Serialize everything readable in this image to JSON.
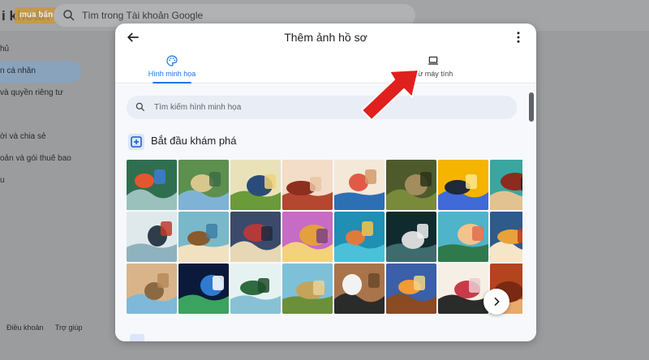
{
  "background": {
    "app_title": "i khoản",
    "logo_text": "mua bán",
    "search_placeholder": "Tìm trong Tài khoản Google",
    "nav": [
      {
        "label": "hủ",
        "active": false
      },
      {
        "label": "n cá nhân",
        "active": true
      },
      {
        "label": "và quyền riêng tư",
        "active": false
      },
      {
        "label": "",
        "active": false
      },
      {
        "label": "ời và chia sẻ",
        "active": false
      },
      {
        "label": "oản và gói thuê bao",
        "active": false
      },
      {
        "label": "u",
        "active": false
      }
    ],
    "footer": [
      "Điều khoản",
      "Trợ giúp"
    ]
  },
  "dialog": {
    "title": "Thêm ảnh hồ sơ",
    "tabs": [
      {
        "label": "Hình minh họa",
        "icon": "palette-icon",
        "active": true
      },
      {
        "label": "Từ máy tính",
        "icon": "laptop-icon",
        "active": false
      }
    ],
    "search_placeholder": "Tìm kiếm hình minh họa",
    "section_title": "Bắt đầu khám phá",
    "thumbnails": [
      {
        "name": "thumb-chameleon",
        "colors": [
          "#2f6f4f",
          "#e4572e",
          "#9bc1bc",
          "#3b7dd8"
        ]
      },
      {
        "name": "thumb-waterfall",
        "colors": [
          "#5d8f4e",
          "#d8c78b",
          "#7fb3d5",
          "#3c6e47"
        ]
      },
      {
        "name": "thumb-temple",
        "colors": [
          "#e9e2b8",
          "#2a4c7d",
          "#6b9a3a",
          "#f1d27a"
        ]
      },
      {
        "name": "thumb-shoes",
        "colors": [
          "#f3dcc8",
          "#8c2f1f",
          "#b5462f",
          "#e8c7a5"
        ]
      },
      {
        "name": "thumb-boxing",
        "colors": [
          "#f4e8d8",
          "#e05a47",
          "#2d6fb5",
          "#d39b6a"
        ]
      },
      {
        "name": "thumb-sloth",
        "colors": [
          "#4f5a2c",
          "#a38c5e",
          "#7a8a3b",
          "#2c3419"
        ]
      },
      {
        "name": "thumb-camera",
        "colors": [
          "#f4b400",
          "#1f2937",
          "#3f6ad8",
          "#fde68a"
        ]
      },
      {
        "name": "thumb-people",
        "colors": [
          "#3aa6a0",
          "#8b2c1e",
          "#e2c290",
          "#222"
        ]
      },
      {
        "name": "thumb-ship",
        "colors": [
          "#dfe9ec",
          "#2f3d4a",
          "#8fb2bf",
          "#c0392b"
        ]
      },
      {
        "name": "thumb-sailboat",
        "colors": [
          "#79b8c9",
          "#8a5a2c",
          "#f2e1c1",
          "#3d7ea6"
        ]
      },
      {
        "name": "thumb-football",
        "colors": [
          "#3b4a6b",
          "#b33a3a",
          "#e6d8b5",
          "#1d2a3f"
        ]
      },
      {
        "name": "thumb-gate",
        "colors": [
          "#c66cc4",
          "#e3a03c",
          "#f3d27c",
          "#7a3f8c"
        ]
      },
      {
        "name": "thumb-fish",
        "colors": [
          "#1f8fb3",
          "#e07a3a",
          "#4bc0d9",
          "#f3c74c"
        ]
      },
      {
        "name": "thumb-astronaut",
        "colors": [
          "#0f2b2e",
          "#d8d8d8",
          "#3d6b6e",
          "#f0f0f0"
        ]
      },
      {
        "name": "thumb-beach",
        "colors": [
          "#4fb3c9",
          "#f2c38b",
          "#2f7a4c",
          "#e36f4c"
        ]
      },
      {
        "name": "thumb-balloon",
        "colors": [
          "#2e5b8a",
          "#e9a23b",
          "#f5e6c8",
          "#c0392b"
        ]
      },
      {
        "name": "thumb-desert-city",
        "colors": [
          "#d9b48a",
          "#8a6a45",
          "#7fb8d8",
          "#b78a5a"
        ]
      },
      {
        "name": "thumb-earth",
        "colors": [
          "#0b1a3a",
          "#2f7bd1",
          "#3aa35f",
          "#ffffff"
        ]
      },
      {
        "name": "thumb-forest",
        "colors": [
          "#e6f2f2",
          "#2f6b3f",
          "#88c1d6",
          "#1f4d2c"
        ]
      },
      {
        "name": "thumb-pyramid",
        "colors": [
          "#7fc0d9",
          "#c4a35a",
          "#6b8f3a",
          "#e6d29a"
        ]
      },
      {
        "name": "thumb-tiger",
        "colors": [
          "#a9744a",
          "#f2f2f2",
          "#2b2b2b",
          "#6b4a2a"
        ]
      },
      {
        "name": "thumb-horse",
        "colors": [
          "#3b5fa8",
          "#f29a38",
          "#8a4a22",
          "#f4d58c"
        ]
      },
      {
        "name": "thumb-bowling",
        "colors": [
          "#f6efe6",
          "#c83a4a",
          "#2b2b2b",
          "#e9cfcf"
        ]
      },
      {
        "name": "thumb-pumpkin",
        "colors": [
          "#b3441e",
          "#7a2a12",
          "#e9aa6b",
          "#f7d6b0"
        ]
      }
    ]
  },
  "annotation": {
    "arrow_color": "#e0201c"
  },
  "colors": {
    "accent": "#1a73e8",
    "content_bg": "#f6f8fc",
    "search_bg": "#e9eef6"
  }
}
